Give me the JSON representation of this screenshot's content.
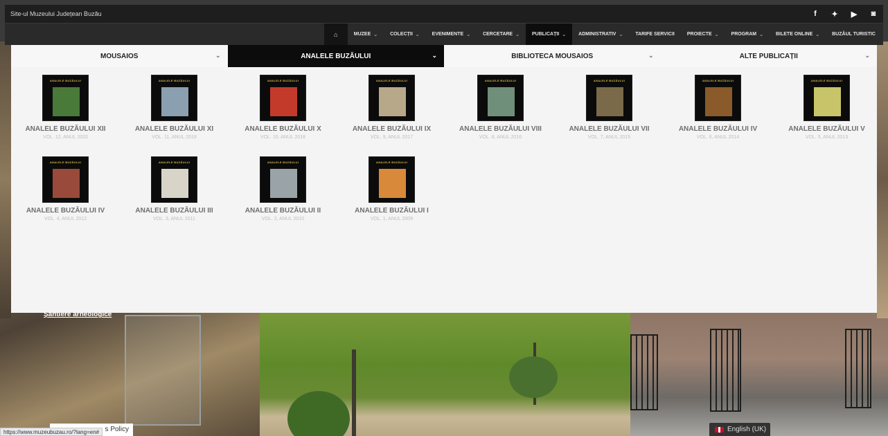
{
  "topbar": {
    "site_title": "Site-ul Muzeului Județean Buzău",
    "social": [
      {
        "icon": "facebook-icon",
        "glyph": "f"
      },
      {
        "icon": "twitter-icon",
        "glyph": "✦"
      },
      {
        "icon": "youtube-icon",
        "glyph": "▶"
      },
      {
        "icon": "instagram-icon",
        "glyph": "◙"
      }
    ]
  },
  "nav": {
    "home_icon": "⌂",
    "items": [
      {
        "label": "MUZEE",
        "caret": "⌄"
      },
      {
        "label": "COLECȚII",
        "caret": "⌄"
      },
      {
        "label": "EVENIMENTE",
        "caret": "⌄"
      },
      {
        "label": "CERCETARE",
        "caret": "⌄"
      },
      {
        "label": "PUBLICAȚII",
        "caret": "⌄"
      },
      {
        "label": "ADMINISTRATIV",
        "caret": "⌄"
      },
      {
        "label": "TARIFE SERVICII",
        "caret": ""
      },
      {
        "label": "PROIECTE",
        "caret": "⌄"
      },
      {
        "label": "PROGRAM",
        "caret": "⌄"
      },
      {
        "label": "BILETE ONLINE",
        "caret": "⌄"
      },
      {
        "label": "BUZĂUL TURISTIC",
        "caret": ""
      }
    ]
  },
  "mega": {
    "tabs": [
      {
        "label": "MOUSAIOS",
        "chev": "⌄"
      },
      {
        "label": "ANALELE BUZĂULUI",
        "chev": "⌄"
      },
      {
        "label": "BIBLIOTECA MOUSAIOS",
        "chev": "⌄"
      },
      {
        "label": "ALTE PUBLICAȚII",
        "chev": "⌄"
      }
    ],
    "items": [
      {
        "cover": "ANALELE BUZĂULUI",
        "title": "ANALELE BUZĂULUI XII",
        "sub": "VOL. 12, ANUL 2020",
        "art": "#4a7a3a"
      },
      {
        "cover": "ANALELE BUZĂULUI",
        "title": "ANALELE BUZĂULUI XI",
        "sub": "VOL. 11, ANUL 2019",
        "art": "#8aa0b0"
      },
      {
        "cover": "ANALELE BUZĂULUI",
        "title": "ANALELE BUZĂULUI X",
        "sub": "VOL. 10, ANUL 2018",
        "art": "#c43a2a"
      },
      {
        "cover": "ANALELE BUZĂULUI",
        "title": "ANALELE BUZĂULUI IX",
        "sub": "VOL. 9, ANUL 2017",
        "art": "#b8a88a"
      },
      {
        "cover": "ANALELE BUZĂULUI",
        "title": "ANALELE BUZĂULUI VIII",
        "sub": "VOL. 8, ANUL 2016",
        "art": "#6f8f7a"
      },
      {
        "cover": "ANALELE BUZĂULUI",
        "title": "ANALELE BUZĂULUI VII",
        "sub": "VOL. 7, ANUL 2015",
        "art": "#7a6a4a"
      },
      {
        "cover": "ANALELE BUZĂULUI",
        "title": "ANALELE BUZĂULUI IV",
        "sub": "VOL. 6, ANUL 2014",
        "art": "#8a5a2a"
      },
      {
        "cover": "ANALELE BUZĂULUI",
        "title": "ANALELE BUZĂULUI V",
        "sub": "VOL. 5, ANUL 2013",
        "art": "#c8c46a"
      },
      {
        "cover": "ANALELE BUZĂULUI",
        "title": "ANALELE BUZĂULUI IV",
        "sub": "VOL. 4, ANUL 2012",
        "art": "#9a4a3a"
      },
      {
        "cover": "ANALELE BUZĂULUI",
        "title": "ANALELE BUZĂULUI III",
        "sub": "VOL. 3, ANUL 2011",
        "art": "#d8d4c8"
      },
      {
        "cover": "ANALELE BUZĂULUI",
        "title": "ANALELE BUZĂULUI II",
        "sub": "VOL. 2, ANUL 2010",
        "art": "#9aa4a8"
      },
      {
        "cover": "ANALELE BUZĂULUI",
        "title": "ANALELE BUZĂULUI I",
        "sub": "VOL. 1, ANUL 2009",
        "art": "#d88a3a"
      }
    ]
  },
  "background": {
    "sites_label": "Șantiere arheologice",
    "cookie_text": "s Policy",
    "status_url": "https://www.muzeubuzau.ro/?lang=en#",
    "language": "English (UK)"
  }
}
